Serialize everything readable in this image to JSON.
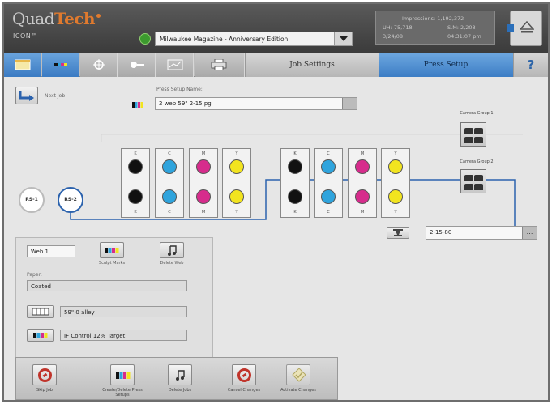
{
  "header": {
    "logo_main": "Quad",
    "logo_accent": "Tech",
    "product": "ICON™",
    "job_name": "Milwaukee Magazine - Anniversary Edition",
    "status": {
      "impressions": "Impressions: 1,192,372",
      "uh": "UH: 75,718",
      "sm": "S.M: 2,208",
      "date": "3/24/08",
      "time": "04:31:07 pm"
    }
  },
  "toolbar": {
    "job_settings": "Job Settings",
    "press_setup": "Press Setup",
    "help": "?"
  },
  "main": {
    "next_job": "Next Job",
    "press_setup_name_label": "Press Setup Name:",
    "press_setup_name": "2 web 59\" 2-15 pg",
    "camera_group_1": "Camera Group 1",
    "camera_group_2": "Camera Group 2",
    "units_left": [
      {
        "top": "K",
        "bottom": "K",
        "top_color": "#111111",
        "bottom_color": "#111111"
      },
      {
        "top": "C",
        "bottom": "C",
        "top_color": "#2fa4dd",
        "bottom_color": "#2fa4dd"
      },
      {
        "top": "M",
        "bottom": "M",
        "top_color": "#d62c8c",
        "bottom_color": "#d62c8c"
      },
      {
        "top": "Y",
        "bottom": "Y",
        "top_color": "#f2e41f",
        "bottom_color": "#f2e41f"
      }
    ],
    "units_right": [
      {
        "top": "K",
        "bottom": "K",
        "top_color": "#111111",
        "bottom_color": "#111111"
      },
      {
        "top": "C",
        "bottom": "C",
        "top_color": "#2fa4dd",
        "bottom_color": "#2fa4dd"
      },
      {
        "top": "M",
        "bottom": "M",
        "top_color": "#d62c8c",
        "bottom_color": "#d62c8c"
      },
      {
        "top": "Y",
        "bottom": "Y",
        "top_color": "#f2e41f",
        "bottom_color": "#f2e41f"
      }
    ],
    "rs1": "RS-1",
    "rs2": "RS-2",
    "folder_value": "2-15-80"
  },
  "web_panel": {
    "web_name": "Web 1",
    "sculpt_marks": "Sculpt Marks",
    "delete_web": "Delete Web",
    "paper_label": "Paper:",
    "paper_value": "Coated",
    "width_value": "59\" 0 alley",
    "control_value": "IF Control 12% Target"
  },
  "bottom_bar": {
    "skip_job": "Skip Job",
    "create_delete_press_setups": "Create/Delete Press Setups",
    "delete_jobs": "Delete Jobs",
    "cancel_changes": "Cancel Changes",
    "activate_changes": "Activate Changes"
  },
  "colors": {
    "accent_blue": "#3b7bc3",
    "web_line": "#2b62ad",
    "logo_orange": "#e07a2e"
  }
}
